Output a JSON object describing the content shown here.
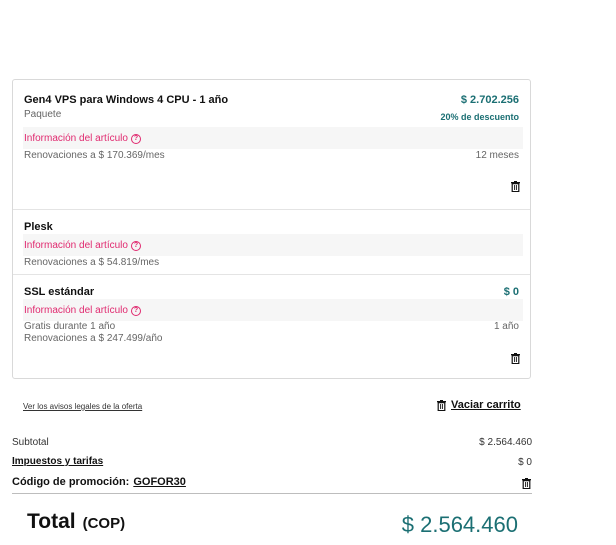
{
  "cart": {
    "items": [
      {
        "name": "Gen4 VPS para Windows 4 CPU - 1 año",
        "subtitle": "Paquete",
        "info_link": "Información del artículo",
        "renewal": "Renovaciones a $ 170.369/mes",
        "price": "$ 2.702.256",
        "discount": "20% de descuento",
        "term": "12 meses"
      },
      {
        "name": "Plesk",
        "info_link": "Información del artículo",
        "renewal": "Renovaciones a $ 54.819/mes"
      },
      {
        "name": "SSL estándar",
        "info_link": "Información del artículo",
        "free_note": "Gratis durante 1 año",
        "renewal": "Renovaciones a $ 247.499/año",
        "price": "$ 0",
        "term": "1 año"
      }
    ],
    "legal_link": "Ver los avisos legales de la oferta",
    "empty_cart": "Vaciar carrito"
  },
  "summary": {
    "subtotal_label": "Subtotal",
    "subtotal_value": "$ 2.564.460",
    "taxes_label": "Impuestos y tarifas",
    "taxes_value": "$ 0",
    "promo_label": "Código de promoción:",
    "promo_code": "GOFOR30",
    "total_label": "Total",
    "total_currency": "(COP)",
    "total_value": "$ 2.564.460"
  },
  "colors": {
    "accent_teal": "#1b6f73",
    "info_pink": "#e0296f"
  },
  "icons": {
    "delete": "trash-icon",
    "help": "question-circle-icon"
  }
}
